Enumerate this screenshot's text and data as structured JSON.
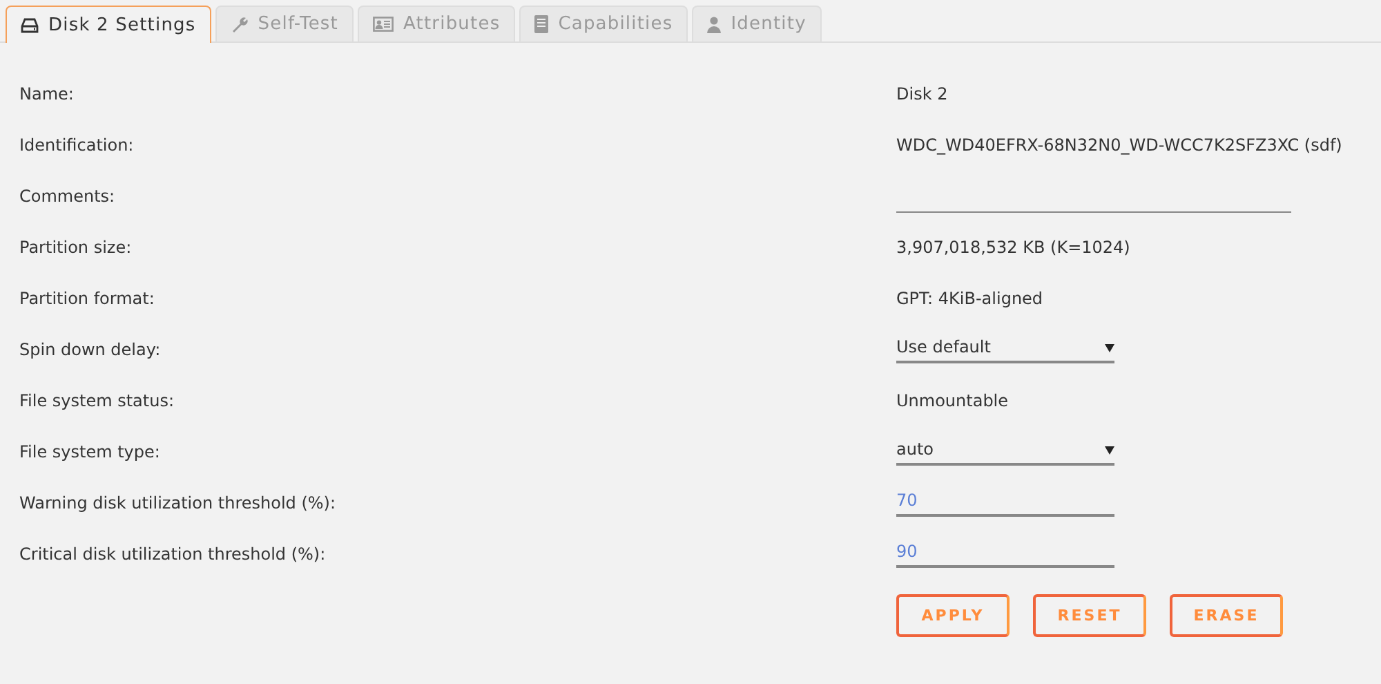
{
  "tabs": [
    {
      "label": "Disk 2 Settings",
      "kind": "disk",
      "selected": true
    },
    {
      "label": "Self-Test",
      "kind": "wrench",
      "selected": false
    },
    {
      "label": "Attributes",
      "kind": "card",
      "selected": false
    },
    {
      "label": "Capabilities",
      "kind": "server",
      "selected": false
    },
    {
      "label": "Identity",
      "kind": "user",
      "selected": false
    }
  ],
  "settings": [
    {
      "label": "Name:",
      "kind": "text",
      "value": "Disk 2"
    },
    {
      "label": "Identification:",
      "kind": "text",
      "value": "WDC_WD40EFRX-68N32N0_WD-WCC7K2SFZ3XC (sdf)"
    },
    {
      "label": "Comments:",
      "kind": "input"
    },
    {
      "label": "Partition size:",
      "kind": "text",
      "value": "3,907,018,532 KB (K=1024)"
    },
    {
      "label": "Partition format:",
      "kind": "text",
      "value": "GPT: 4KiB-aligned"
    },
    {
      "label": "Spin down delay:",
      "kind": "select",
      "value": "Use default"
    },
    {
      "label": "File system status:",
      "kind": "text",
      "value": "Unmountable"
    },
    {
      "label": "File system type:",
      "kind": "select",
      "value": "auto"
    },
    {
      "label": "Warning disk utilization threshold (%):",
      "kind": "number",
      "value": "70"
    },
    {
      "label": "Critical disk utilization threshold (%):",
      "kind": "number",
      "value": "90"
    }
  ],
  "buttons": [
    "APPLY",
    "RESET",
    "ERASE"
  ]
}
